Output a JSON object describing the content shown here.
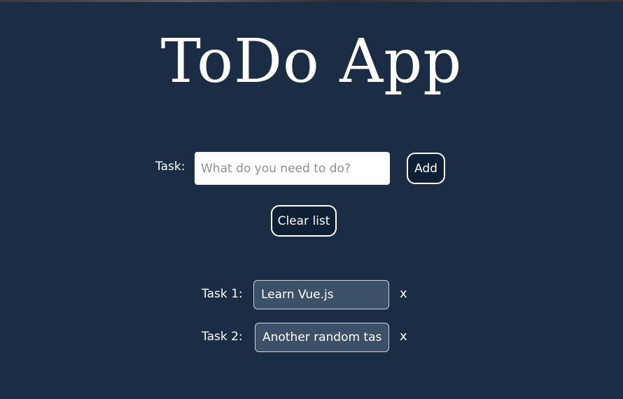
{
  "app": {
    "title": "ToDo App"
  },
  "form": {
    "task_label": "Task:",
    "input_placeholder": "What do you need to do?",
    "input_value": "",
    "add_label": "Add",
    "clear_label": "Clear list"
  },
  "tasks": [
    {
      "label": "Task 1:",
      "value": "Learn Vue.js",
      "remove": "x"
    },
    {
      "label": "Task 2:",
      "value": "Another random task",
      "remove": "x"
    }
  ],
  "colors": {
    "background": "#1b2d45",
    "button_bg": "#0f1f35",
    "task_input_bg": "#3c5068",
    "text": "#ffffff"
  }
}
